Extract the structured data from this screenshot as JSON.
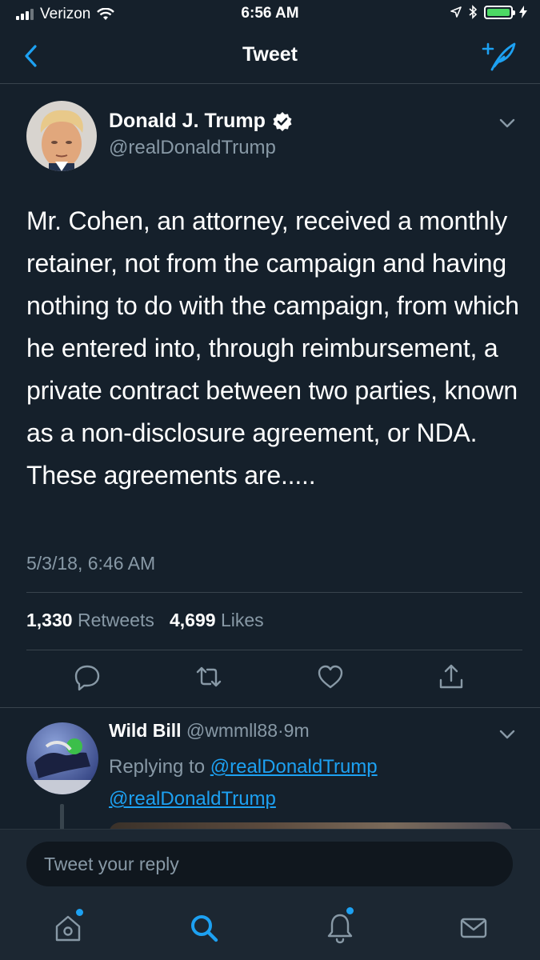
{
  "status_bar": {
    "carrier": "Verizon",
    "time": "6:56 AM",
    "battery_color": "#4cd964",
    "icons": [
      "signal-icon",
      "wifi-icon",
      "location-arrow-icon",
      "bluetooth-icon",
      "battery-icon",
      "charging-bolt-icon"
    ]
  },
  "nav": {
    "title": "Tweet",
    "back_icon": "chevron-left-icon",
    "compose_icon": "compose-tweet-icon"
  },
  "tweet": {
    "author_name": "Donald J. Trump",
    "author_handle": "@realDonaldTrump",
    "verified": true,
    "text": "Mr. Cohen, an attorney, received a monthly retainer, not from the campaign and having nothing to do with the campaign, from which he entered into, through reimbursement, a private contract between two parties, known as a non-disclosure agreement, or NDA. These agreements are.....",
    "timestamp": "5/3/18, 6:46 AM",
    "retweets_count": "1,330",
    "retweets_label": "Retweets",
    "likes_count": "4,699",
    "likes_label": "Likes",
    "actions": [
      "reply-icon",
      "retweet-icon",
      "like-icon",
      "share-icon"
    ]
  },
  "reply": {
    "name": "Wild Bill",
    "handle": "@wmmll88",
    "separator": "·",
    "time": "9m",
    "replying_prefix": "Replying to",
    "mentions": [
      "@realDonaldTrump",
      "@realDonaldTrump"
    ]
  },
  "reply_bar": {
    "placeholder": "Tweet your reply"
  },
  "tab_bar": {
    "tabs": [
      "home-icon",
      "search-icon",
      "notifications-icon",
      "messages-icon"
    ],
    "active": "search-icon"
  },
  "colors": {
    "background": "#15202b",
    "accent": "#1da1f2",
    "secondary_text": "#8899a6",
    "divider": "#38444d"
  }
}
